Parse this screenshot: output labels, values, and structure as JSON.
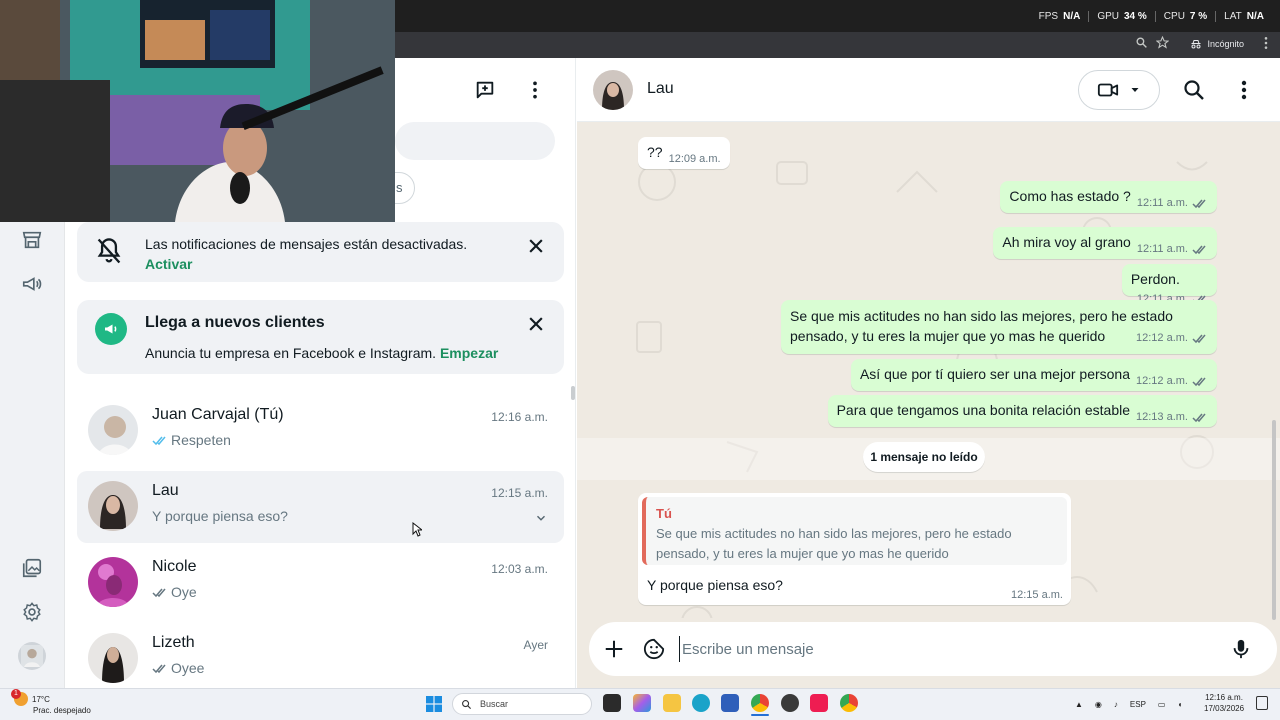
{
  "overlay": {
    "stats": [
      {
        "label": "FPS",
        "value": "N/A"
      },
      {
        "label": "GPU",
        "value": "34 %"
      },
      {
        "label": "CPU",
        "value": "7 %"
      },
      {
        "label": "LAT",
        "value": "N/A"
      }
    ]
  },
  "browser": {
    "incognito_label": "Incógnito"
  },
  "notifications_card": {
    "text": "Las notificaciones de mensajes están desactivadas.",
    "action": "Activar"
  },
  "promo_card": {
    "title": "Llega a nuevos clientes",
    "text": "Anuncia tu empresa en Facebook e Instagram.",
    "action": "Empezar"
  },
  "filter_chip_partial": "s",
  "chats": [
    {
      "name": "Juan Carvajal (Tú)",
      "time": "12:16 a.m.",
      "preview": "Respeten",
      "ticks": "read"
    },
    {
      "name": "Lau",
      "time": "12:15 a.m.",
      "preview": "Y porque piensa eso?",
      "ticks": "none"
    },
    {
      "name": "Nicole",
      "time": "12:03 a.m.",
      "preview": "Oye",
      "ticks": "sent"
    },
    {
      "name": "Lizeth",
      "time": "Ayer",
      "preview": "Oyee",
      "ticks": "sent"
    }
  ],
  "conversation": {
    "contact_name": "Lau",
    "messages": [
      {
        "dir": "in",
        "text": "??",
        "time": "12:09 a.m."
      },
      {
        "dir": "out",
        "text": "Como has estado ?",
        "time": "12:11 a.m."
      },
      {
        "dir": "out",
        "text": "Ah mira voy al grano",
        "time": "12:11 a.m."
      },
      {
        "dir": "out",
        "text": "Perdon.",
        "time": "12:11 a.m."
      },
      {
        "dir": "out",
        "text": "Se que mis actitudes no han sido las mejores, pero he estado pensado, y tu eres la mujer que yo mas he querido",
        "time": "12:12 a.m."
      },
      {
        "dir": "out",
        "text": "Así que por tí quiero ser una mejor persona",
        "time": "12:12 a.m."
      },
      {
        "dir": "out",
        "text": "Para que tengamos una bonita relación estable",
        "time": "12:13 a.m."
      }
    ],
    "unread_label": "1 mensaje no leído",
    "reply": {
      "quote_author": "Tú",
      "quote_text": "Se que mis actitudes no han sido las mejores, pero he estado pensado, y tu eres la mujer que yo mas he querido",
      "text": "Y porque piensa eso?",
      "time": "12:15 a.m."
    },
    "composer_placeholder": "Escribe un mensaje"
  },
  "taskbar": {
    "weather_temp": "17°C",
    "weather_desc": "Prac. despejado",
    "weather_badge": "1",
    "search_label": "Buscar",
    "lang": "ESP",
    "time": "12:16 a.m.",
    "date": "17/03/2026"
  },
  "colors": {
    "accent_green": "#1c8f5f",
    "outgoing_bubble": "#d9fdd3",
    "chat_background": "#efeae2",
    "read_ticks": "#53bdeb"
  }
}
